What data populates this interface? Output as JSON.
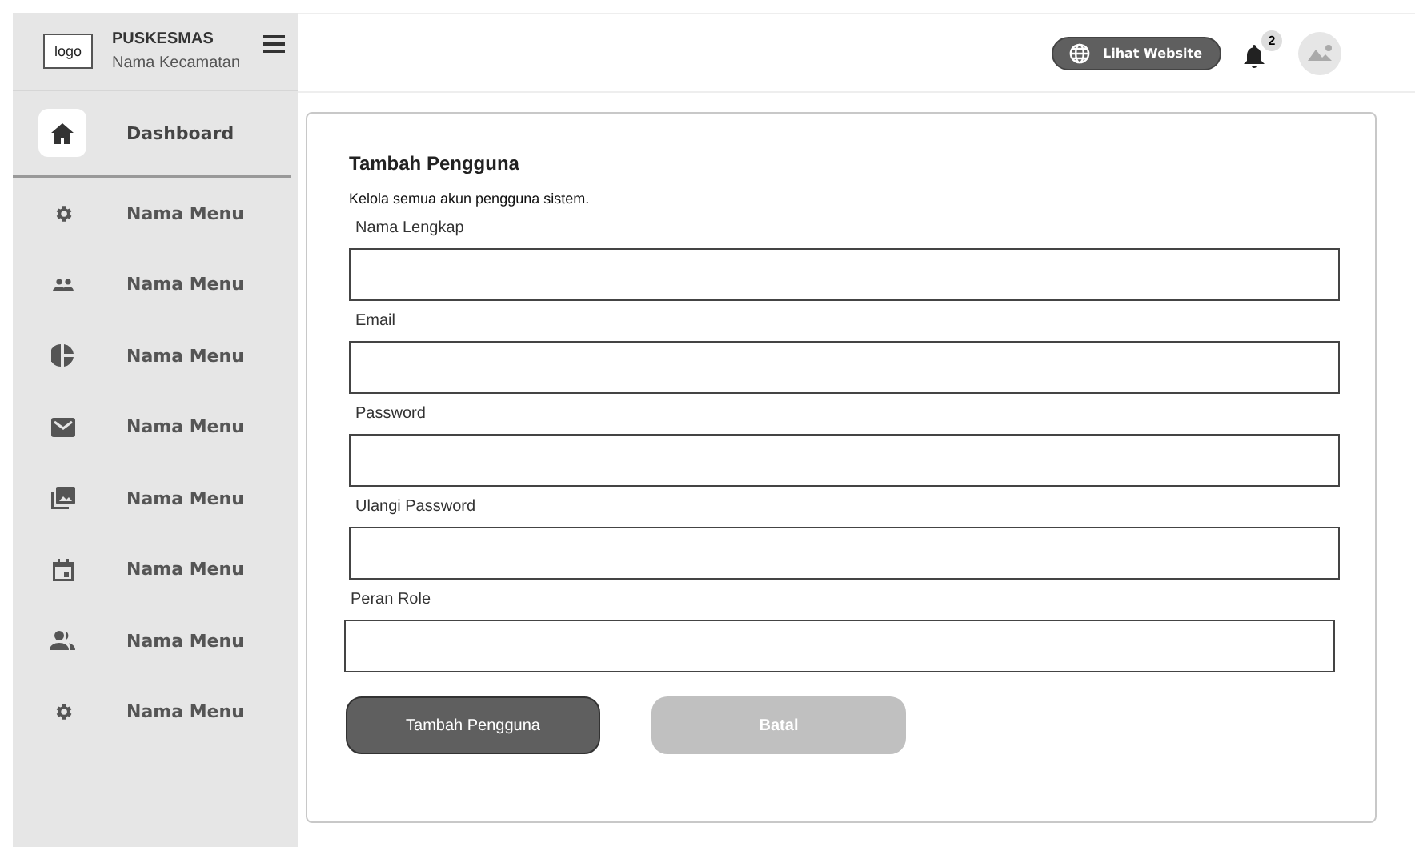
{
  "brand": {
    "logo": "logo",
    "title": "PUSKESMAS",
    "subtitle": "Nama Kecamatan"
  },
  "sidebar": {
    "items": [
      {
        "label": "Dashboard",
        "kind": "home",
        "selected": true
      },
      {
        "label": "Nama Menu",
        "kind": "gear",
        "selected": false
      },
      {
        "label": "Nama Menu",
        "kind": "people",
        "selected": false
      },
      {
        "label": "Nama Menu",
        "kind": "pie",
        "selected": false
      },
      {
        "label": "Nama Menu",
        "kind": "mail",
        "selected": false
      },
      {
        "label": "Nama Menu",
        "kind": "images",
        "selected": false
      },
      {
        "label": "Nama Menu",
        "kind": "calendar",
        "selected": false
      },
      {
        "label": "Nama Menu",
        "kind": "group",
        "selected": false
      },
      {
        "label": "Nama Menu",
        "kind": "gear",
        "selected": false
      }
    ]
  },
  "header": {
    "website_button": "Lihat Website",
    "notification_count": "2"
  },
  "form": {
    "title": "Tambah Pengguna",
    "description": "Kelola semua akun pengguna sistem.",
    "fields": [
      {
        "label": "Nama Lengkap"
      },
      {
        "label": "Email"
      },
      {
        "label": "Password"
      },
      {
        "label": "Ulangi Password"
      },
      {
        "label": "Peran Role"
      }
    ],
    "buttons": [
      {
        "label": "Tambah Pengguna",
        "kind": "primary"
      },
      {
        "label": "Batal",
        "kind": "secondary"
      }
    ]
  }
}
